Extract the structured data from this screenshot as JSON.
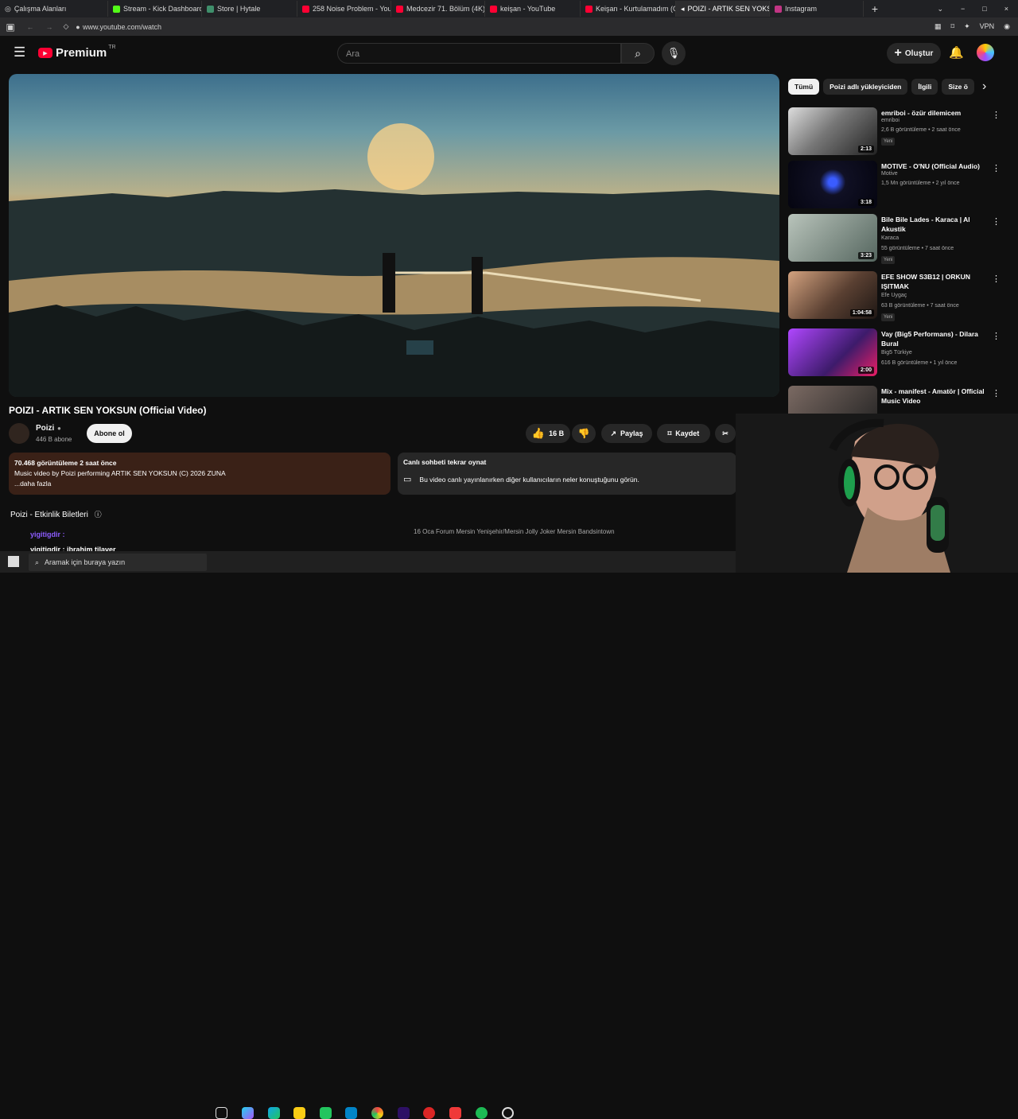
{
  "browser": {
    "workspace": "Çalışma Alanları",
    "tabs": [
      {
        "label": "Stream - Kick Dashboard",
        "color": "#53fc18"
      },
      {
        "label": "Store | Hytale",
        "color": "#3f8f6b"
      },
      {
        "label": "258 Noise Problem - YouTu",
        "color": "#ff0033"
      },
      {
        "label": "Medcezir 71. Bölüm (4K) -",
        "color": "#ff0033"
      },
      {
        "label": "keişan - YouTube",
        "color": "#ff0033"
      },
      {
        "label": "Keişan - Kurtulamadım (Of",
        "color": "#ff0033"
      },
      {
        "label": "POIZI - ARTIK SEN YOKSUN",
        "color": "#ff0033"
      },
      {
        "label": "Instagram",
        "color": "#c13584"
      }
    ],
    "url": "www.youtube.com/watch"
  },
  "youtube": {
    "logo": "Premium",
    "logo_sup": "TR",
    "search_placeholder": "Ara",
    "create": "Oluştur"
  },
  "video": {
    "title": "POIZI - ARTIK SEN YOKSUN (Official Video)",
    "channel": "Poizi",
    "subscribers": "446 B abone",
    "subscribe": "Abone ol",
    "likes": "16 B",
    "share": "Paylaş",
    "save": "Kaydet",
    "views_time": "70.468 görüntüleme  2 saat önce",
    "description": "Music video by Poizi performing ARTIK SEN YOKSUN (C) 2026 ZUNA",
    "more": "...daha fazla",
    "chat_title": "Canlı sohbeti tekrar oynat",
    "chat_text": "Bu video canlı yayınlanırken diğer kullanıcıların neler konuştuğunu görün.",
    "events_title": "Poizi - Etkinlik Biletleri",
    "event_line": "16 Oca  Forum Mersin Yenişehir/Mersin  Jolly Joker Mersin  Bandsintown"
  },
  "chips": [
    "Tümü",
    "Poizi adlı yükleyiciden",
    "İlgili",
    "Size ö"
  ],
  "recommendations": [
    {
      "title": "emriboi - özür dilemicem",
      "channel": "emriboi",
      "meta": "2,6 B görüntüleme • 2 saat önce",
      "badge": "Yeni",
      "duration": "2:13",
      "thumb": "#b7b7b7"
    },
    {
      "title": "MOTIVE - O'NU (Official Audio)",
      "channel": "Motive",
      "meta": "1,5 Mn görüntüleme • 2 yıl önce",
      "badge": "",
      "duration": "3:18",
      "thumb": "#101024"
    },
    {
      "title": "Bile Bile Lades - Karaca | Al Akustik",
      "channel": "Karaca",
      "meta": "55 görüntüleme • 7 saat önce",
      "badge": "Yeni",
      "duration": "3:23",
      "thumb": "#71807b"
    },
    {
      "title": "EFE SHOW S3B12 | ORKUN IŞITMAK",
      "channel": "Efe Uygaç",
      "meta": "63 B görüntüleme • 7 saat önce",
      "badge": "Yeni",
      "duration": "1:04:58",
      "thumb": "#9b6f4a"
    },
    {
      "title": "Vay (Big5 Performans) - Dilara Bural",
      "channel": "Big5 Türkiye",
      "meta": "616 B görüntüleme • 1 yıl önce",
      "badge": "",
      "duration": "2:00",
      "thumb": "#7631a9"
    },
    {
      "title": "Mix - manifest - Amatör | Official Music Video",
      "channel": "",
      "meta": "",
      "badge": "",
      "duration": "",
      "thumb": "#614f48"
    }
  ],
  "overlay": {
    "chat1": "yigitigdir :",
    "chat2": "yigitigdir : ibrahim tilaver",
    "search": "Aramak için buraya yazın"
  }
}
